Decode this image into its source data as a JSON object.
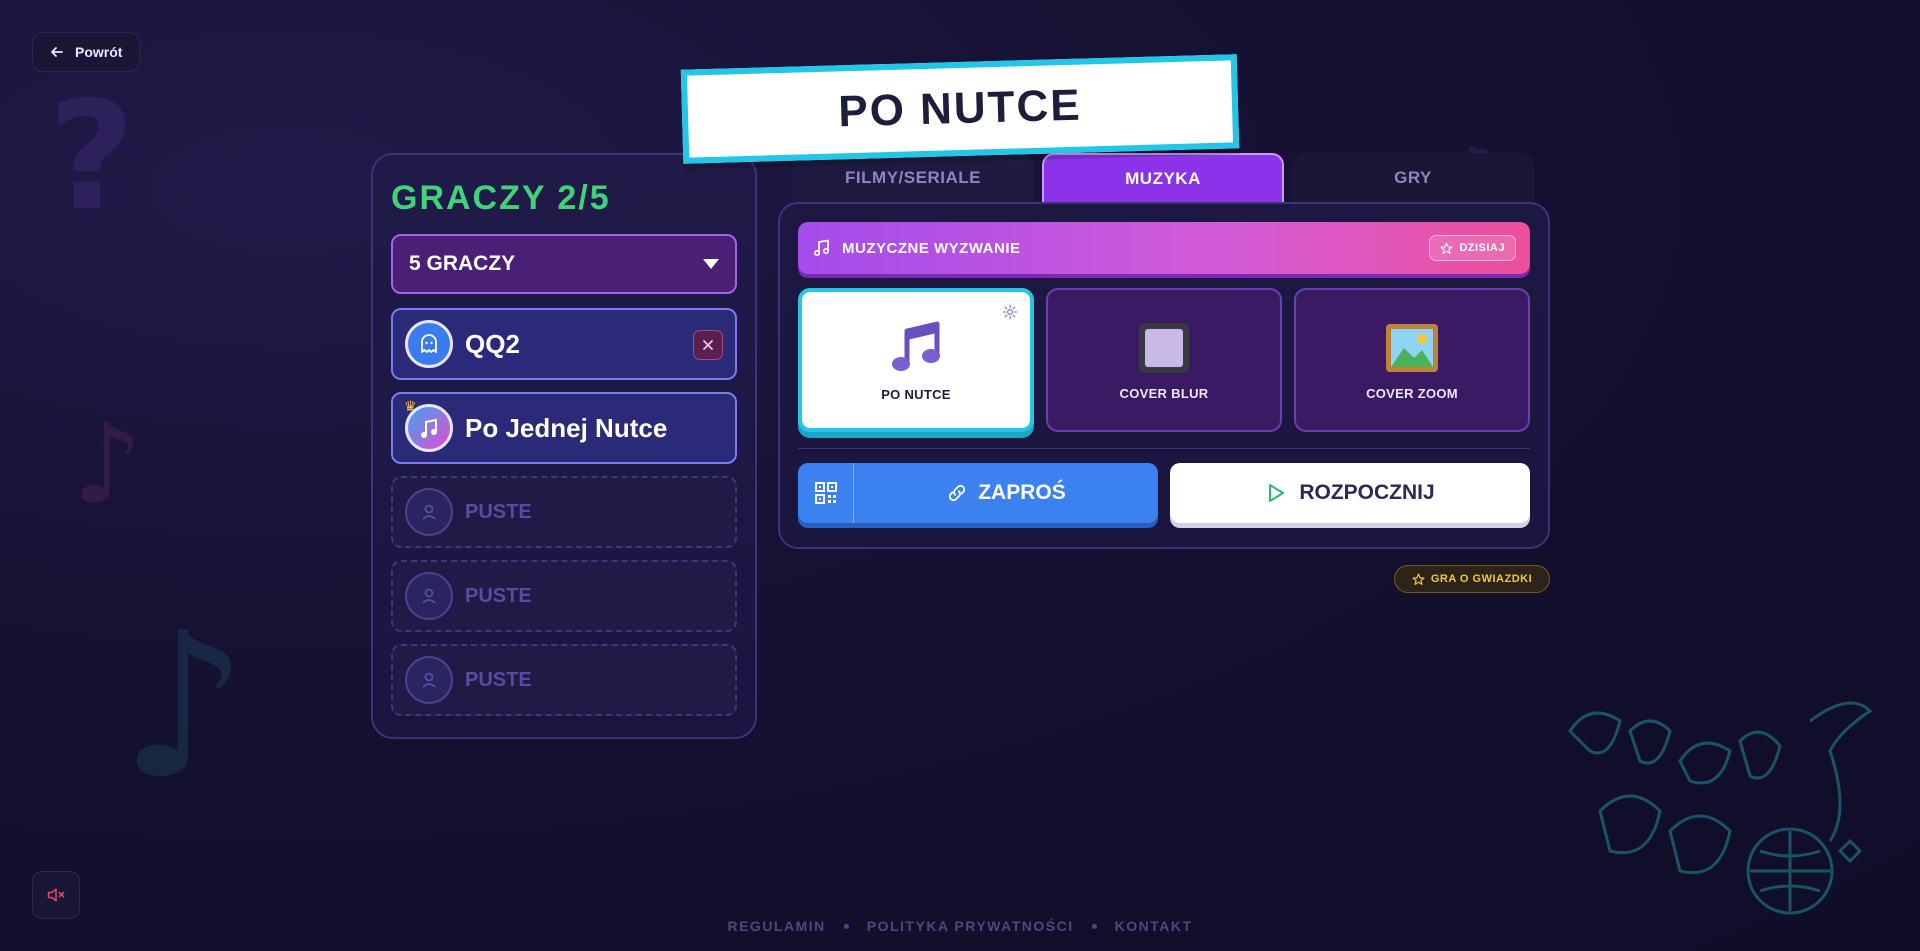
{
  "nav": {
    "back_label": "Powrót"
  },
  "title": "PO NUTCE",
  "players": {
    "title": "GRACZY 2/5",
    "count_select": "5 GRACZY",
    "slots": [
      {
        "name": "QQ2",
        "state": "filled",
        "avatar": "ghost-icon",
        "removable": true
      },
      {
        "name": "Po Jednej Nutce",
        "state": "filled",
        "avatar": "music-avatar-icon",
        "host": true
      },
      {
        "name": "PUSTE",
        "state": "empty"
      },
      {
        "name": "PUSTE",
        "state": "empty"
      },
      {
        "name": "PUSTE",
        "state": "empty"
      }
    ]
  },
  "tabs": [
    {
      "label": "FILMY/SERIALE",
      "active": false
    },
    {
      "label": "MUZYKA",
      "active": true
    },
    {
      "label": "GRY",
      "active": false
    }
  ],
  "challenge": {
    "label": "MUZYCZNE WYZWANIE",
    "badge": "DZISIAJ"
  },
  "modes": [
    {
      "label": "PO NUTCE",
      "icon": "music-note-icon",
      "active": true
    },
    {
      "label": "COVER BLUR",
      "icon": "blur-square-icon",
      "active": false
    },
    {
      "label": "COVER ZOOM",
      "icon": "picture-icon",
      "active": false
    }
  ],
  "actions": {
    "invite": "ZAPROŚ",
    "start": "ROZPOCZNIJ"
  },
  "stars_badge": "GRA O GWIAZDKI",
  "footer": {
    "links": [
      "REGULAMIN",
      "POLITYKA PRYWATNOŚCI",
      "KONTAKT"
    ]
  },
  "colors": {
    "background": "#120f2c",
    "accent_cyan": "#22c6e6",
    "accent_purple": "#8b33e8",
    "players_title": "#3fd47a",
    "invite_blue": "#3b82f0",
    "gold": "#f3c640"
  }
}
